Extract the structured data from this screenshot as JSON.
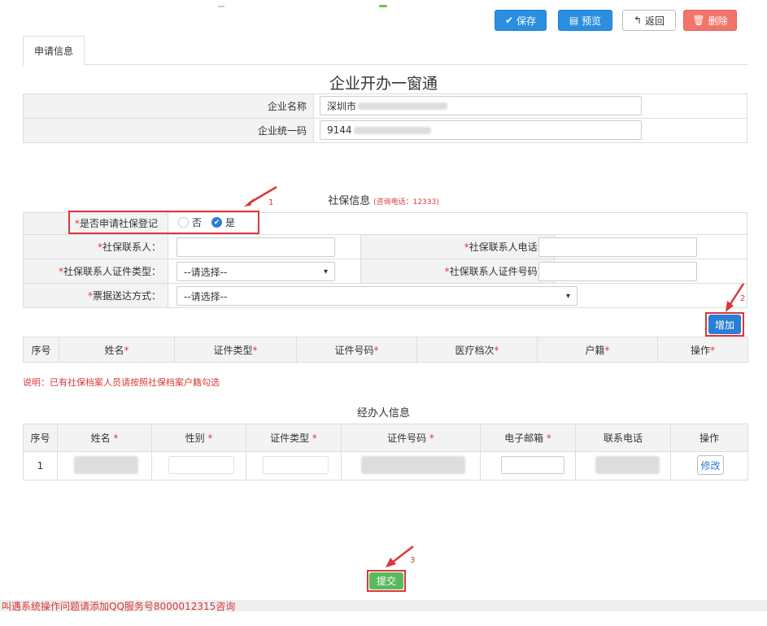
{
  "toolbar": {
    "save_label": "保存",
    "preview_label": "预览",
    "back_label": "返回",
    "delete_label": "删除"
  },
  "tab": {
    "label": "申请信息"
  },
  "page_title": "企业开办一窗通",
  "company": {
    "name_label": "企业名称",
    "name_value": "深圳市",
    "code_label": "企业统一码",
    "code_value": "9144"
  },
  "social": {
    "section_title": "社保信息",
    "hotline": "(咨询电话：12333)",
    "apply_label": "是否申请社保登记",
    "option_no": "否",
    "option_yes": "是",
    "contact_label": "社保联系人：",
    "phone_label": "社保联系人电话：",
    "id_type_label": "社保联系人证件类型：",
    "id_number_label": "社保联系人证件号码：",
    "delivery_label": "票据送达方式：",
    "select_placeholder": "--请选择--",
    "add_label": "增加",
    "columns": [
      "序号",
      "姓名",
      "证件类型",
      "证件号码",
      "医疗档次",
      "户籍",
      "操作"
    ],
    "note": "说明：已有社保档案人员请按照社保档案户籍勾选"
  },
  "agent": {
    "section_title": "经办人信息",
    "columns": [
      "序号",
      "姓名",
      "性别",
      "证件类型",
      "证件号码",
      "电子邮箱",
      "联系电话",
      "操作"
    ],
    "row_index": "1",
    "edit_label": "修改"
  },
  "markers": [
    "1",
    "2",
    "3"
  ],
  "submit_label": "提交",
  "footer": "叫遇系统操作问题请添加QQ服务号8000012315咨询",
  "colors": {
    "primary": "#2a8fe0",
    "danger": "#f2756a",
    "submit": "#5cb85c",
    "highlight": "#d9383a"
  }
}
